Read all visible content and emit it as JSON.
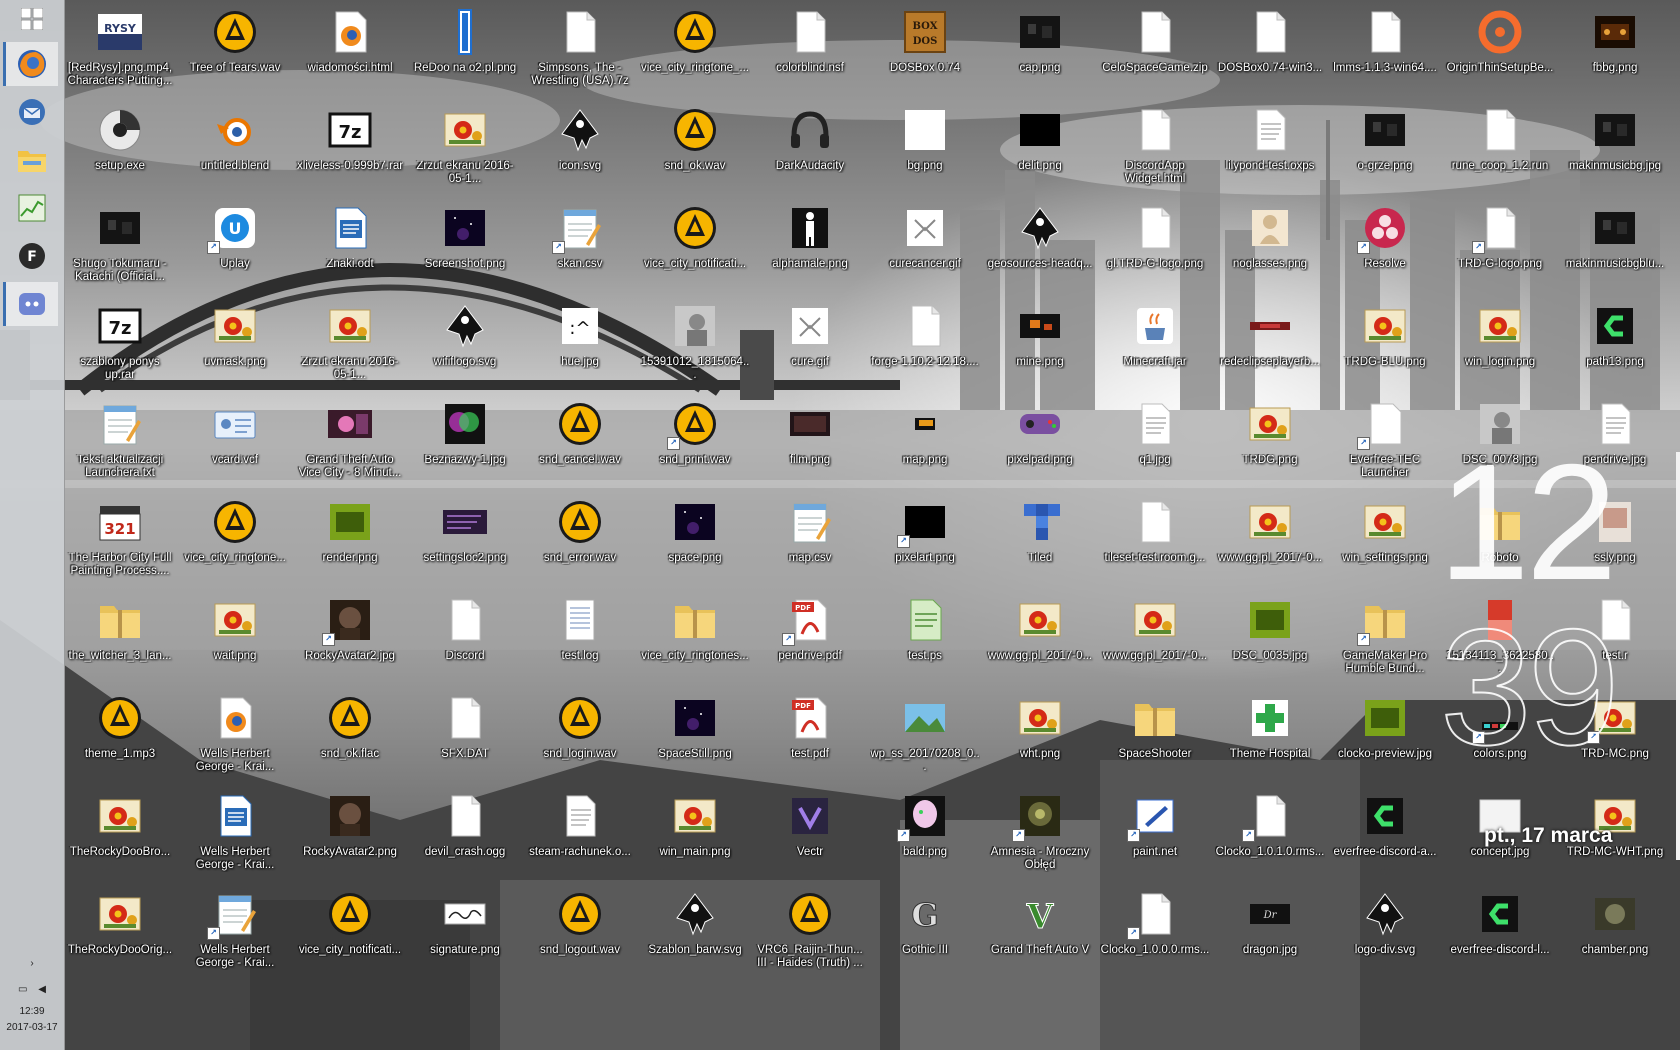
{
  "taskbar": {
    "pinned": [
      {
        "name": "start-button",
        "icon": "windows-logo-icon"
      },
      {
        "name": "firefox",
        "icon": "firefox-icon"
      },
      {
        "name": "thunderbird",
        "icon": "thunderbird-icon"
      },
      {
        "name": "file-explorer",
        "icon": "folder-icon"
      },
      {
        "name": "task-manager",
        "icon": "chart-icon"
      },
      {
        "name": "f-app",
        "icon": "f-letter-icon"
      },
      {
        "name": "discord",
        "icon": "discord-icon"
      }
    ],
    "time": "12:39",
    "date": "2017-03-17",
    "tray_arrow": "›"
  },
  "clock": {
    "hours": "12",
    "minutes": "39",
    "date": "pt., 17 marca"
  },
  "desktop": {
    "columns": [
      [
        "[RedRysy].png.mp4, Characters Putting...",
        "setup.exe",
        "Shugo Tokumaru - Katachi (Official...",
        "szablony ponys up.rar",
        "Tekst aktualizacji Launchera.txt",
        "The Harbor City Full Painting Process....",
        "the_witcher_3_lan...",
        "theme_1.mp3",
        "TheRockyDooBro...",
        "TheRockyDooOrig..."
      ],
      [
        "Tree of Tears.wav",
        "untitled.blend",
        "Uplay",
        "uvmask.png",
        "vcard.vcf",
        "vice_city_ringtone...",
        "wait.png",
        "Wells Herbert George - Krai...",
        "Wells Herbert George - Krai...",
        "Wells Herbert George - Krai..."
      ],
      [
        "wiadomości.html",
        "xliveless-0.999b7.rar",
        "Znaki.odt",
        "Zrzut ekranu 2016-05-1...",
        "Grand Theft Auto Vice City - 8 Minut...",
        "render.png",
        "RockyAvatar2.jpg",
        "snd_ok.flac",
        "RockyAvatar2.png",
        "vice_city_notificati..."
      ],
      [
        "ReDoo na o2.pl.png",
        "Zrzut ekranu 2016-05-1...",
        "Screenshot.png",
        "wififlogo.svg",
        "Beznazwy-1.jpg",
        "settingsloc2.png",
        "Discord",
        "SFX.DAT",
        "devil_crash.ogg",
        "signature.png"
      ],
      [
        "Simpsons, The - Wrestling (USA).7z",
        "icon.svg",
        "skan.csv",
        "hue.jpg",
        "snd_cancel.wav",
        "snd_error.wav",
        "test.log",
        "snd_login.wav",
        "steam-rachunek.o...",
        "snd_logout.wav"
      ],
      [
        "vice_city_ringtone_...",
        "snd_ok.wav",
        "vice_city_notificati...",
        "15391012_1815064...",
        "snd_print.wav",
        "space.png",
        "vice_city_ringtones...",
        "SpaceStill.png",
        "win_main.png",
        "Szablon_barw.svg"
      ],
      [
        "colorblind.nsf",
        "DarkAudacity",
        "alphamale.png",
        "cure.gif",
        "film.png",
        "map.csv",
        "pendrive.pdf",
        "test.pdf",
        "Vectr",
        "VRC6_Raijin-Thun... III - Haides (Truth) ..."
      ],
      [
        "DOSBox 0.74",
        "bg.png",
        "curecancer.gif",
        "forge-1.10.2-12.18....",
        "map.png",
        "pixelart.png",
        "test.ps",
        "wp_ss_20170208_0...",
        "bald.png",
        "Gothic III"
      ],
      [
        "cap.png",
        "delit.png",
        "geosources-headq...",
        "mine.png",
        "pixelpad.png",
        "Tiled",
        "www.gg.pl_2017-0...",
        "wht.png",
        "Amnesia - Mroczny Obłęd",
        "Grand Theft Auto V"
      ],
      [
        "CeloSpaceGame.zip",
        "DiscordApp Widget.html",
        "gl.TRD-G-logo.png",
        "Minecraft.jar",
        "q1.jpg",
        "tileset-test.room.g...",
        "www.gg.pl_2017-0...",
        "SpaceShooter",
        "paint.net",
        "Clocko_1.0.0.0.rms..."
      ],
      [
        "DOSBox0.74-win3...",
        "lilypond-test.oxps",
        "noglasses.png",
        "redeclipseplayerb...",
        "TRDG.png",
        "www.gg.pl_2017-0...",
        "DSC_0035.jpg",
        "Theme Hospital",
        "Clocko_1.0.1.0.rms...",
        "dragon.jpg"
      ],
      [
        "lmms-1.1.3-win64....",
        "o-grze.png",
        "Resolve",
        "TRDG-BLU.png",
        "Everfree-TEC Launcher",
        "win_settings.png",
        "GameMaker Pro Humble Bund...",
        "clocko-preview.jpg",
        "everfree-discord-a...",
        "logo-div.svg"
      ],
      [
        "OriginThinSetupBe...",
        "rune_coop_1.2.run",
        "TRD-G-logo.png",
        "win_login.png",
        "DSC_0078.jpg",
        "Roboto",
        "15134113_3622580...",
        "colors.png",
        "concept.jpg",
        "everfree-discord-l..."
      ],
      [
        "fbbg.png",
        "makinmusicbg.jpg",
        "makinmusicbgblu...",
        "path13.png",
        "pendrive.jpg",
        "ssly.png",
        "test.r",
        "TRD-MC.png",
        "TRD-MC-WHT.png",
        "chamber.png"
      ]
    ],
    "icon_types": [
      [
        "image-rysy",
        "cd-disc",
        "photo-dark",
        "archive-7z",
        "notepad",
        "clapper-321",
        "zip-folder",
        "vlc-cone",
        "flower-image",
        "flower-image"
      ],
      [
        "vlc-cone",
        "blender",
        "uplay",
        "flower-image",
        "vcard",
        "vlc-cone",
        "flower-image",
        "firefox-doc",
        "writer-doc",
        "notepad"
      ],
      [
        "firefox-doc",
        "archive-7z",
        "writer-doc",
        "flower-image",
        "photo-pink",
        "photo-green",
        "photo-face",
        "vlc-cone",
        "photo-face",
        "vlc-cone"
      ],
      [
        "blue-bar",
        "flower-image",
        "photo-space",
        "inkscape",
        "photo-color",
        "photo-settings",
        "blank-doc",
        "blank-doc",
        "blank-doc",
        "signature-doc"
      ],
      [
        "blank-doc",
        "inkscape",
        "notepad",
        "hue-face",
        "vlc-cone",
        "vlc-cone",
        "text-lines",
        "vlc-cone",
        "text-doc",
        "vlc-cone"
      ],
      [
        "vlc-cone",
        "vlc-cone",
        "vlc-cone",
        "photo-grey",
        "vlc-cone",
        "photo-space",
        "zip-folder",
        "photo-space",
        "flower-image",
        "inkscape"
      ],
      [
        "blank-doc",
        "headphones",
        "photo-person",
        "cure-doc",
        "photo-film",
        "notepad",
        "pdf-doc",
        "pdf-doc",
        "vectr",
        "vlc-cone"
      ],
      [
        "dosbox",
        "blank-white",
        "cure-doc",
        "blank-doc",
        "photo-car",
        "photo-black",
        "ps-doc",
        "photo-landscape",
        "photo-bald",
        "gothic-g"
      ],
      [
        "photo-dark",
        "photo-black",
        "inkscape",
        "photo-mine",
        "gamepad",
        "tiled",
        "flower-image",
        "flower-image",
        "photo-amnesia",
        "gta-v"
      ],
      [
        "blank-doc",
        "blank-doc",
        "blank-doc",
        "java-cup",
        "text-doc",
        "blank-doc",
        "flower-image",
        "zip-folder",
        "paint-net",
        "blank-doc"
      ],
      [
        "blank-doc",
        "text-doc",
        "photo-figure",
        "photo-strip",
        "flower-image",
        "flower-image",
        "photo-green",
        "theme-hospital",
        "blank-doc",
        "photo-dragon"
      ],
      [
        "blank-doc",
        "photo-dark",
        "resolve",
        "flower-image",
        "shortcut-doc",
        "flower-image",
        "zip-folder",
        "photo-green",
        "clocko-green",
        "inkscape"
      ],
      [
        "origin",
        "blank-doc",
        "blank-doc",
        "flower-image",
        "photo-grey",
        "zip-folder",
        "photo-red",
        "photo-colors",
        "photo-white",
        "clocko-green"
      ],
      [
        "photo-fb",
        "photo-dark",
        "photo-dark",
        "clocko-green",
        "text-doc",
        "photo-ssly",
        "blank-doc",
        "flower-image",
        "flower-image",
        "photo-chamber"
      ]
    ],
    "shortcuts": [
      "1-2",
      "1-9",
      "2-6",
      "4-2",
      "5-4",
      "6-6",
      "7-5",
      "7-8",
      "8-8",
      "9-8",
      "9-9",
      "10-8",
      "11-2",
      "11-4",
      "11-6",
      "12-2",
      "12-7",
      "13-7"
    ]
  }
}
